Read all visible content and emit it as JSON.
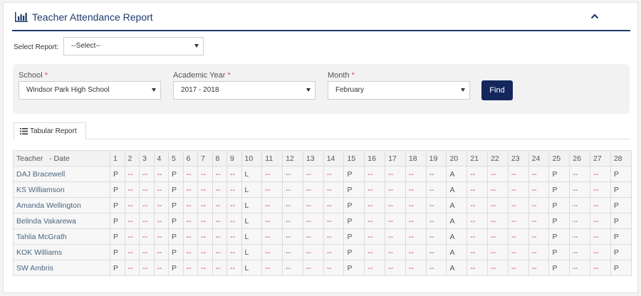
{
  "header": {
    "title": "Teacher Attendance Report",
    "icon": "bar-chart-icon",
    "collapse_icon": "chevron-up-icon",
    "accent_color": "#1e3a6e"
  },
  "report_selector": {
    "label": "Select Report:",
    "value": "--Select--"
  },
  "filters": {
    "school": {
      "label": "School",
      "required_mark": "*",
      "value": "Windsor Park High School"
    },
    "academic_year": {
      "label": "Academic Year",
      "required_mark": "*",
      "value": "2017 - 2018"
    },
    "month": {
      "label": "Month",
      "required_mark": "*",
      "value": "February"
    },
    "find_label": "Find",
    "find_color": "#14275c"
  },
  "tabs": [
    {
      "label": "Tabular Report",
      "icon": "list-icon"
    }
  ],
  "table": {
    "name_header": "Teacher   - Date",
    "days": [
      "1",
      "2",
      "3",
      "4",
      "5",
      "6",
      "7",
      "8",
      "9",
      "10",
      "11",
      "12",
      "13",
      "14",
      "15",
      "16",
      "17",
      "18",
      "19",
      "20",
      "21",
      "22",
      "23",
      "24",
      "25",
      "26",
      "27",
      "28"
    ],
    "rows": [
      {
        "teacher": "DAJ Bracewell",
        "marks": [
          "P",
          "--",
          "--",
          "--",
          "P",
          "--",
          "--",
          "--",
          "--",
          "L",
          "--",
          "--",
          "--",
          "--",
          "P",
          "--",
          "--",
          "--",
          "--",
          "A",
          "--",
          "--",
          "--",
          "--",
          "P",
          "--",
          "--",
          "P"
        ]
      },
      {
        "teacher": "KS Williamson",
        "marks": [
          "P",
          "--",
          "--",
          "--",
          "P",
          "--",
          "--",
          "--",
          "--",
          "L",
          "--",
          "--",
          "--",
          "--",
          "P",
          "--",
          "--",
          "--",
          "--",
          "A",
          "--",
          "--",
          "--",
          "--",
          "P",
          "--",
          "--",
          "P"
        ]
      },
      {
        "teacher": "Amanda Wellington",
        "marks": [
          "P",
          "--",
          "--",
          "--",
          "P",
          "--",
          "--",
          "--",
          "--",
          "L",
          "--",
          "--",
          "--",
          "--",
          "P",
          "--",
          "--",
          "--",
          "--",
          "A",
          "--",
          "--",
          "--",
          "--",
          "P",
          "--",
          "--",
          "P"
        ]
      },
      {
        "teacher": "Belinda Vakarewa",
        "marks": [
          "P",
          "--",
          "--",
          "--",
          "P",
          "--",
          "--",
          "--",
          "--",
          "L",
          "--",
          "--",
          "--",
          "--",
          "P",
          "--",
          "--",
          "--",
          "--",
          "A",
          "--",
          "--",
          "--",
          "--",
          "P",
          "--",
          "--",
          "P"
        ]
      },
      {
        "teacher": "Tahlia McGrath",
        "marks": [
          "P",
          "--",
          "--",
          "--",
          "P",
          "--",
          "--",
          "--",
          "--",
          "L",
          "--",
          "--",
          "--",
          "--",
          "P",
          "--",
          "--",
          "--",
          "--",
          "A",
          "--",
          "--",
          "--",
          "--",
          "P",
          "--",
          "--",
          "P"
        ]
      },
      {
        "teacher": "KOK Williams",
        "marks": [
          "P",
          "--",
          "--",
          "--",
          "P",
          "--",
          "--",
          "--",
          "--",
          "L",
          "--",
          "--",
          "--",
          "--",
          "P",
          "--",
          "--",
          "--",
          "--",
          "A",
          "--",
          "--",
          "--",
          "--",
          "P",
          "--",
          "--",
          "P"
        ]
      },
      {
        "teacher": "SW Ambris",
        "marks": [
          "P",
          "--",
          "--",
          "--",
          "P",
          "--",
          "--",
          "--",
          "--",
          "L",
          "--",
          "--",
          "--",
          "--",
          "P",
          "--",
          "--",
          "--",
          "--",
          "A",
          "--",
          "--",
          "--",
          "--",
          "P",
          "--",
          "--",
          "P"
        ]
      }
    ],
    "dash_color": "#d23a3a"
  }
}
